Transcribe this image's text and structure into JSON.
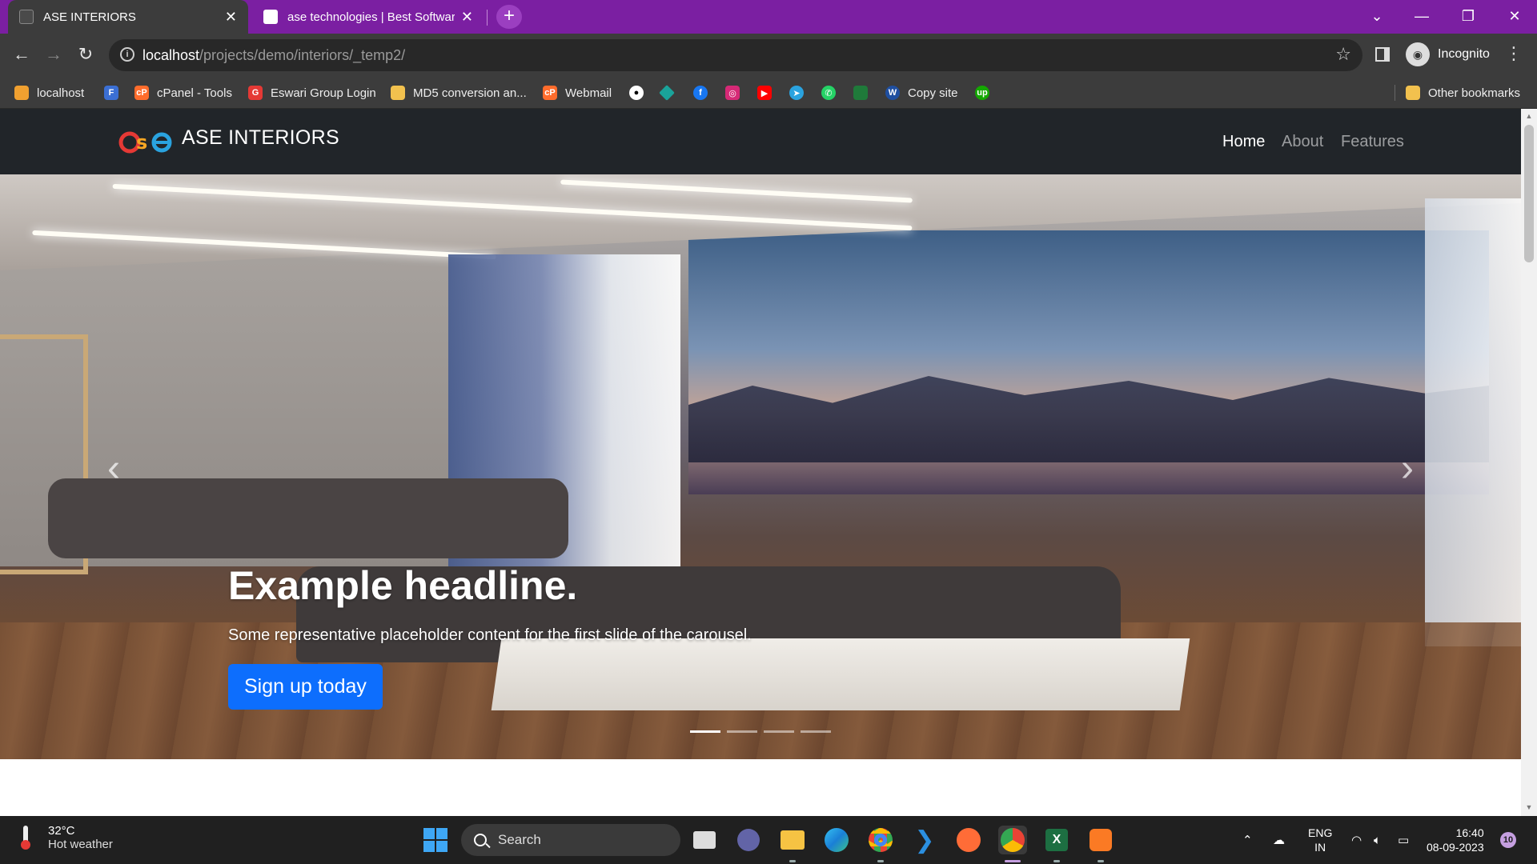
{
  "browser": {
    "tabs": [
      {
        "title": "ASE INTERIORS",
        "active": true
      },
      {
        "title": "ase technologies | Best Software",
        "active": false
      }
    ],
    "new_tab_label": "+",
    "window_controls": {
      "minimize": "—",
      "restore": "❐",
      "close": "✕",
      "tab_search": "⌄"
    },
    "nav": {
      "back": "←",
      "forward": "→",
      "reload": "↻"
    },
    "url_host": "localhost",
    "url_path": "/projects/demo/interiors/_temp2/",
    "profile_label": "Incognito",
    "bookmarks": [
      {
        "label": "localhost",
        "icon": "localhost-icon",
        "color": "#f0a030"
      },
      {
        "label": "",
        "icon": "f-icon",
        "color": "#3b6fd4"
      },
      {
        "label": "cPanel - Tools",
        "icon": "cpanel-icon",
        "color": "#ff6c2c"
      },
      {
        "label": "Eswari Group Login",
        "icon": "eswari-icon",
        "color": "#e53935"
      },
      {
        "label": "MD5 conversion an...",
        "icon": "md5-icon",
        "color": "#f2c14e"
      },
      {
        "label": "Webmail",
        "icon": "webmail-icon",
        "color": "#ff6c2c"
      },
      {
        "label": "",
        "icon": "github-icon",
        "color": "#ffffff"
      },
      {
        "label": "",
        "icon": "diamond-icon",
        "color": "#1aa39a"
      },
      {
        "label": "",
        "icon": "facebook-icon",
        "color": "#1877f2"
      },
      {
        "label": "",
        "icon": "instagram-icon",
        "color": "#d62976"
      },
      {
        "label": "",
        "icon": "youtube-icon",
        "color": "#ff0000"
      },
      {
        "label": "",
        "icon": "telegram-icon",
        "color": "#2aa3df"
      },
      {
        "label": "",
        "icon": "whatsapp-icon",
        "color": "#25d366"
      },
      {
        "label": "",
        "icon": "sheet-icon",
        "color": "#1f7a3a"
      },
      {
        "label": "Copy site",
        "icon": "copy-site-icon",
        "color": "#1f4fa0"
      },
      {
        "label": "",
        "icon": "upwork-icon",
        "color": "#14a800"
      }
    ],
    "other_bookmarks": "Other bookmarks"
  },
  "site": {
    "brand": "ASE INTERIORS",
    "nav": [
      {
        "label": "Home",
        "active": true
      },
      {
        "label": "About",
        "active": false
      },
      {
        "label": "Features",
        "active": false
      }
    ],
    "carousel": {
      "headline": "Example headline.",
      "text": "Some representative placeholder content for the first slide of the carousel.",
      "cta": "Sign up today",
      "prev_glyph": "‹",
      "next_glyph": "›",
      "slides": 4,
      "active_slide": 1
    }
  },
  "taskbar": {
    "weather_temp": "32°C",
    "weather_desc": "Hot weather",
    "search_placeholder": "Search",
    "lang_top": "ENG",
    "lang_bottom": "IN",
    "time": "16:40",
    "date": "08-09-2023",
    "notifications": "10",
    "apps": [
      "task-view-icon",
      "teams-icon",
      "file-explorer-icon",
      "edge-icon",
      "chrome-icon",
      "vscode-icon",
      "postman-icon",
      "chrome-active-icon",
      "excel-icon",
      "xampp-icon"
    ]
  }
}
